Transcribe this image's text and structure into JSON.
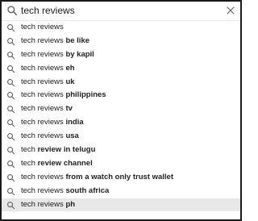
{
  "search": {
    "value": "tech reviews",
    "icon": "search-icon",
    "clear_icon": "close-icon"
  },
  "colors": {
    "highlight": "#e8e8e8",
    "text": "#202124",
    "icon": "#5f6368"
  },
  "suggestions": [
    {
      "prefix": "tech reviews",
      "suffix": ""
    },
    {
      "prefix": "tech reviews ",
      "suffix": "be like"
    },
    {
      "prefix": "tech reviews ",
      "suffix": "by kapil"
    },
    {
      "prefix": "tech reviews ",
      "suffix": "eh"
    },
    {
      "prefix": "tech reviews ",
      "suffix": "uk"
    },
    {
      "prefix": "tech reviews ",
      "suffix": "philippines"
    },
    {
      "prefix": "tech reviews ",
      "suffix": "tv"
    },
    {
      "prefix": "tech reviews ",
      "suffix": "india"
    },
    {
      "prefix": "tech reviews ",
      "suffix": "usa"
    },
    {
      "prefix": "tech ",
      "suffix": "review in telugu"
    },
    {
      "prefix": "tech ",
      "suffix": "review channel"
    },
    {
      "prefix": "tech reviews ",
      "suffix": "from a watch only trust wallet"
    },
    {
      "prefix": "tech reviews ",
      "suffix": "south africa"
    },
    {
      "prefix": "tech reviews ",
      "suffix": "ph",
      "highlighted": true
    }
  ]
}
